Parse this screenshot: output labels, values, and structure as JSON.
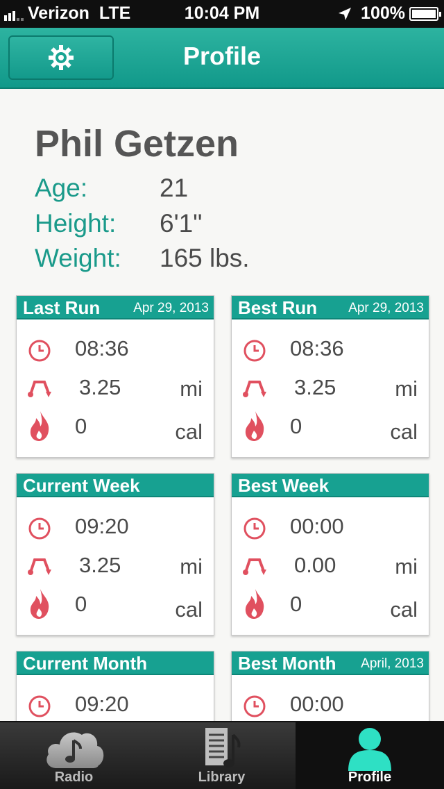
{
  "status_bar": {
    "carrier": "Verizon",
    "network": "LTE",
    "time": "10:04 PM",
    "battery": "100%"
  },
  "nav": {
    "title": "Profile",
    "settings_icon": "gear-icon"
  },
  "profile": {
    "name": "Phil Getzen",
    "stats": [
      {
        "label": "Age:",
        "value": "21"
      },
      {
        "label": "Height:",
        "value": "6'1\""
      },
      {
        "label": "Weight:",
        "value": "165 lbs."
      }
    ]
  },
  "cards": [
    {
      "title": "Last Run",
      "date": "Apr 29, 2013",
      "time": "08:36",
      "distance": "3.25",
      "distance_unit": "mi",
      "calories": "0",
      "calories_unit": "cal"
    },
    {
      "title": "Best Run",
      "date": "Apr 29, 2013",
      "time": "08:36",
      "distance": "3.25",
      "distance_unit": "mi",
      "calories": "0",
      "calories_unit": "cal"
    },
    {
      "title": "Current Week",
      "date": "",
      "time": "09:20",
      "distance": "3.25",
      "distance_unit": "mi",
      "calories": "0",
      "calories_unit": "cal"
    },
    {
      "title": "Best Week",
      "date": "",
      "time": "00:00",
      "distance": "0.00",
      "distance_unit": "mi",
      "calories": "0",
      "calories_unit": "cal"
    },
    {
      "title": "Current Month",
      "date": "",
      "time": "09:20"
    },
    {
      "title": "Best Month",
      "date": "April, 2013",
      "time": "00:00"
    }
  ],
  "tabs": [
    {
      "label": "Radio",
      "icon": "radio-icon",
      "active": false
    },
    {
      "label": "Library",
      "icon": "library-icon",
      "active": false
    },
    {
      "label": "Profile",
      "icon": "profile-icon",
      "active": true
    }
  ],
  "colors": {
    "accent": "#17a191",
    "icon_red": "#e0505f",
    "active_tab_icon": "#2ee0c4"
  }
}
